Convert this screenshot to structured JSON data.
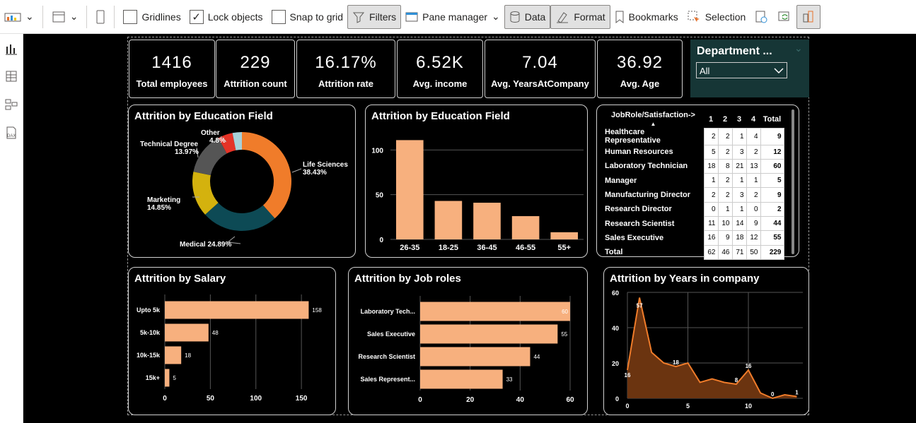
{
  "ribbon": {
    "gridlines": "Gridlines",
    "lock_objects": "Lock objects",
    "snap_to_grid": "Snap to grid",
    "filters": "Filters",
    "pane_manager": "Pane manager",
    "data": "Data",
    "format": "Format",
    "bookmarks": "Bookmarks",
    "selection": "Selection",
    "lock_checked": "✓"
  },
  "kpis": [
    {
      "value": "1416",
      "label": "Total employees"
    },
    {
      "value": "229",
      "label": "Attrition count"
    },
    {
      "value": "16.17%",
      "label": "Attrition rate"
    },
    {
      "value": "6.52K",
      "label": "Avg. income"
    },
    {
      "value": "7.04",
      "label": "Avg. YearsAtCompany"
    },
    {
      "value": "36.92",
      "label": "Avg. Age"
    }
  ],
  "slicer": {
    "title": "Department ...",
    "value": "All",
    "chevron": "⌄"
  },
  "matrix": {
    "header": "JobRole/Satisfaction->",
    "cols": [
      "1",
      "2",
      "3",
      "4",
      "Total"
    ],
    "rows": [
      {
        "name": "Healthcare Representative",
        "vals": [
          "2",
          "2",
          "1",
          "4",
          "9"
        ]
      },
      {
        "name": "Human Resources",
        "vals": [
          "5",
          "2",
          "3",
          "2",
          "12"
        ]
      },
      {
        "name": "Laboratory Technician",
        "vals": [
          "18",
          "8",
          "21",
          "13",
          "60"
        ]
      },
      {
        "name": "Manager",
        "vals": [
          "1",
          "2",
          "1",
          "1",
          "5"
        ]
      },
      {
        "name": "Manufacturing Director",
        "vals": [
          "2",
          "2",
          "3",
          "2",
          "9"
        ]
      },
      {
        "name": "Research Director",
        "vals": [
          "0",
          "1",
          "1",
          "0",
          "2"
        ]
      },
      {
        "name": "Research Scientist",
        "vals": [
          "11",
          "10",
          "14",
          "9",
          "44"
        ]
      },
      {
        "name": "Sales Executive",
        "vals": [
          "16",
          "9",
          "18",
          "12",
          "55"
        ]
      }
    ],
    "total": {
      "name": "Total",
      "vals": [
        "62",
        "46",
        "71",
        "50",
        "229"
      ]
    }
  },
  "chart_data": [
    {
      "type": "pie",
      "title": "Attrition by Education Field",
      "categories": [
        "Life Sciences",
        "Medical",
        "Marketing",
        "Technical Degree",
        "Other",
        ""
      ],
      "values": [
        38.43,
        24.89,
        14.85,
        13.97,
        4.8,
        3.06
      ],
      "labels": [
        "Life Sciences 38.43%",
        "Medical 24.89%",
        "Marketing 14.85%",
        "Technical Degree 13.97%",
        "Other 4.8%"
      ],
      "colors": [
        "#f07c2a",
        "#0d4a55",
        "#d4b20e",
        "#555555",
        "#e53327",
        "#a8d1d9"
      ]
    },
    {
      "type": "bar",
      "title": "Attrition by Education Field",
      "categories": [
        "26-35",
        "18-25",
        "36-45",
        "46-55",
        "55+"
      ],
      "values": [
        111,
        43,
        41,
        26,
        8
      ],
      "ylim": [
        0,
        120
      ],
      "yticks": [
        0,
        50,
        100
      ],
      "color": "#f7b07e"
    },
    {
      "type": "bar",
      "orientation": "horizontal",
      "title": "Attrition by Salary",
      "categories": [
        "Upto 5k",
        "5k-10k",
        "10k-15k",
        "15k+"
      ],
      "values": [
        158,
        48,
        18,
        5
      ],
      "xlim": [
        0,
        160
      ],
      "xticks": [
        0,
        50,
        100,
        150
      ],
      "color": "#f7b07e"
    },
    {
      "type": "bar",
      "orientation": "horizontal",
      "title": "Attrition by Job roles",
      "categories": [
        "Laboratory Tech...",
        "Sales Executive",
        "Research Scientist",
        "Sales Represent..."
      ],
      "values": [
        60,
        55,
        44,
        33
      ],
      "xlim": [
        0,
        60
      ],
      "xticks": [
        0,
        20,
        40,
        60
      ],
      "color": "#f7b07e"
    },
    {
      "type": "area",
      "title": "Attrition by Years in company",
      "x": [
        0,
        1,
        2,
        3,
        4,
        5,
        6,
        7,
        8,
        9,
        10,
        11,
        12,
        13,
        14
      ],
      "values": [
        16,
        57,
        26,
        20,
        18,
        20,
        9,
        11,
        9,
        8,
        16,
        3,
        0,
        2,
        1
      ],
      "labels": {
        "0": "16",
        "1": "57",
        "4": "18",
        "9": "8",
        "10": "16",
        "12": "0",
        "14": "1"
      },
      "xlim": [
        0,
        14.5
      ],
      "ylim": [
        0,
        60
      ],
      "xticks": [
        0,
        5,
        10
      ],
      "yticks": [
        0,
        20,
        40,
        60
      ],
      "color": "#f07c2a"
    }
  ]
}
